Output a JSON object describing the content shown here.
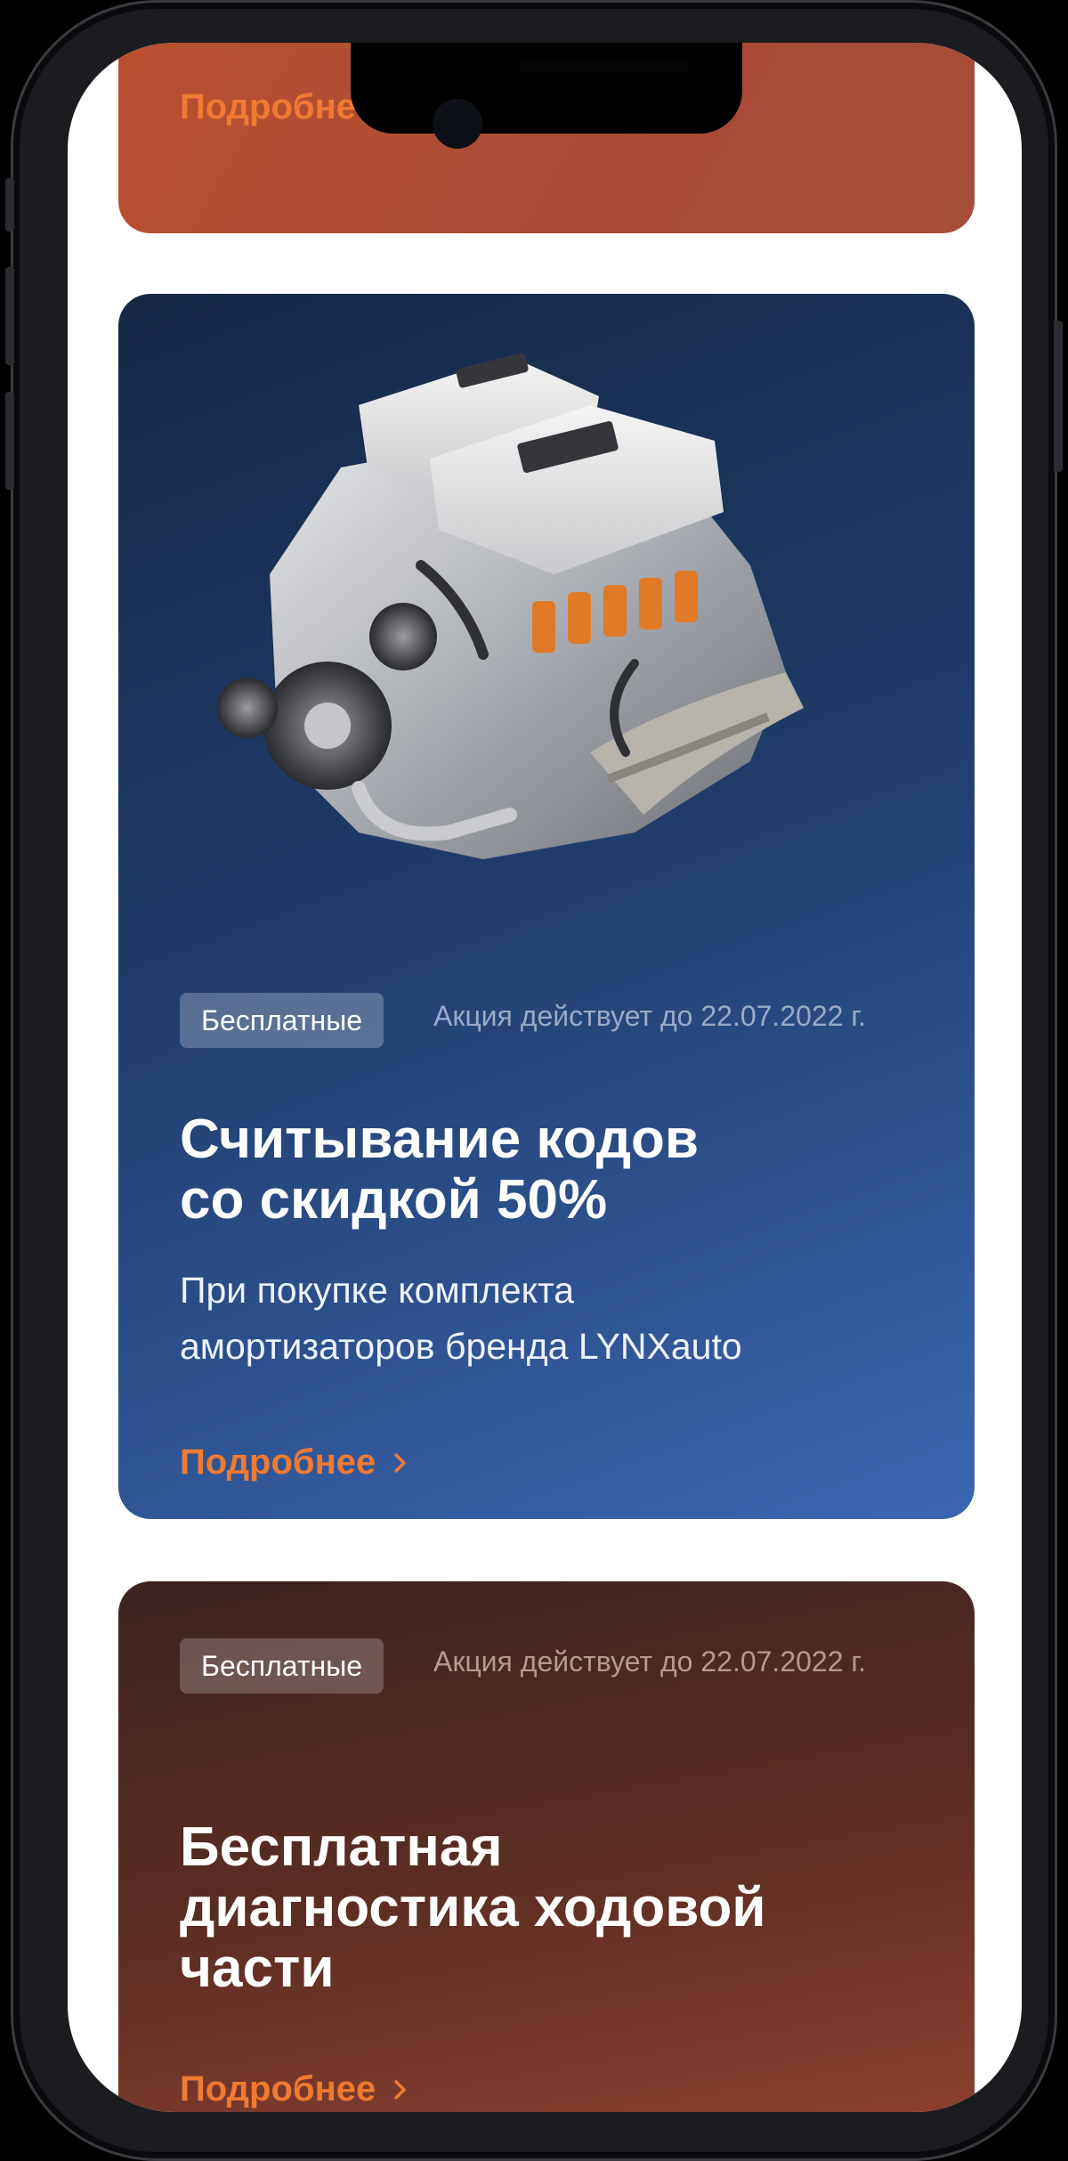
{
  "cards": [
    {
      "more_label": "Подробнее"
    },
    {
      "badge": "Бесплатные",
      "date_note": "Акция действует до 22.07.2022 г.",
      "title_line1": "Считывание кодов",
      "title_line2": "со скидкой 50%",
      "subtitle_line1": "При покупке комплекта",
      "subtitle_line2": "амортизаторов бренда LYNXauto",
      "more_label": "Подробнее",
      "image_icon": "engine-image"
    },
    {
      "badge": "Бесплатные",
      "date_note": "Акция действует до 22.07.2022 г.",
      "title_line1": "Бесплатная",
      "title_line2": "диагностика ходовой",
      "title_line3": "части",
      "more_label": "Подробнее"
    }
  ],
  "colors": {
    "accent": "#f07a32",
    "blue_card_start": "#162745",
    "blue_card_end": "#3a66b2",
    "brown_card_start": "#3b2320",
    "brown_card_end": "#9a4433",
    "top_card": "#b9512f"
  }
}
